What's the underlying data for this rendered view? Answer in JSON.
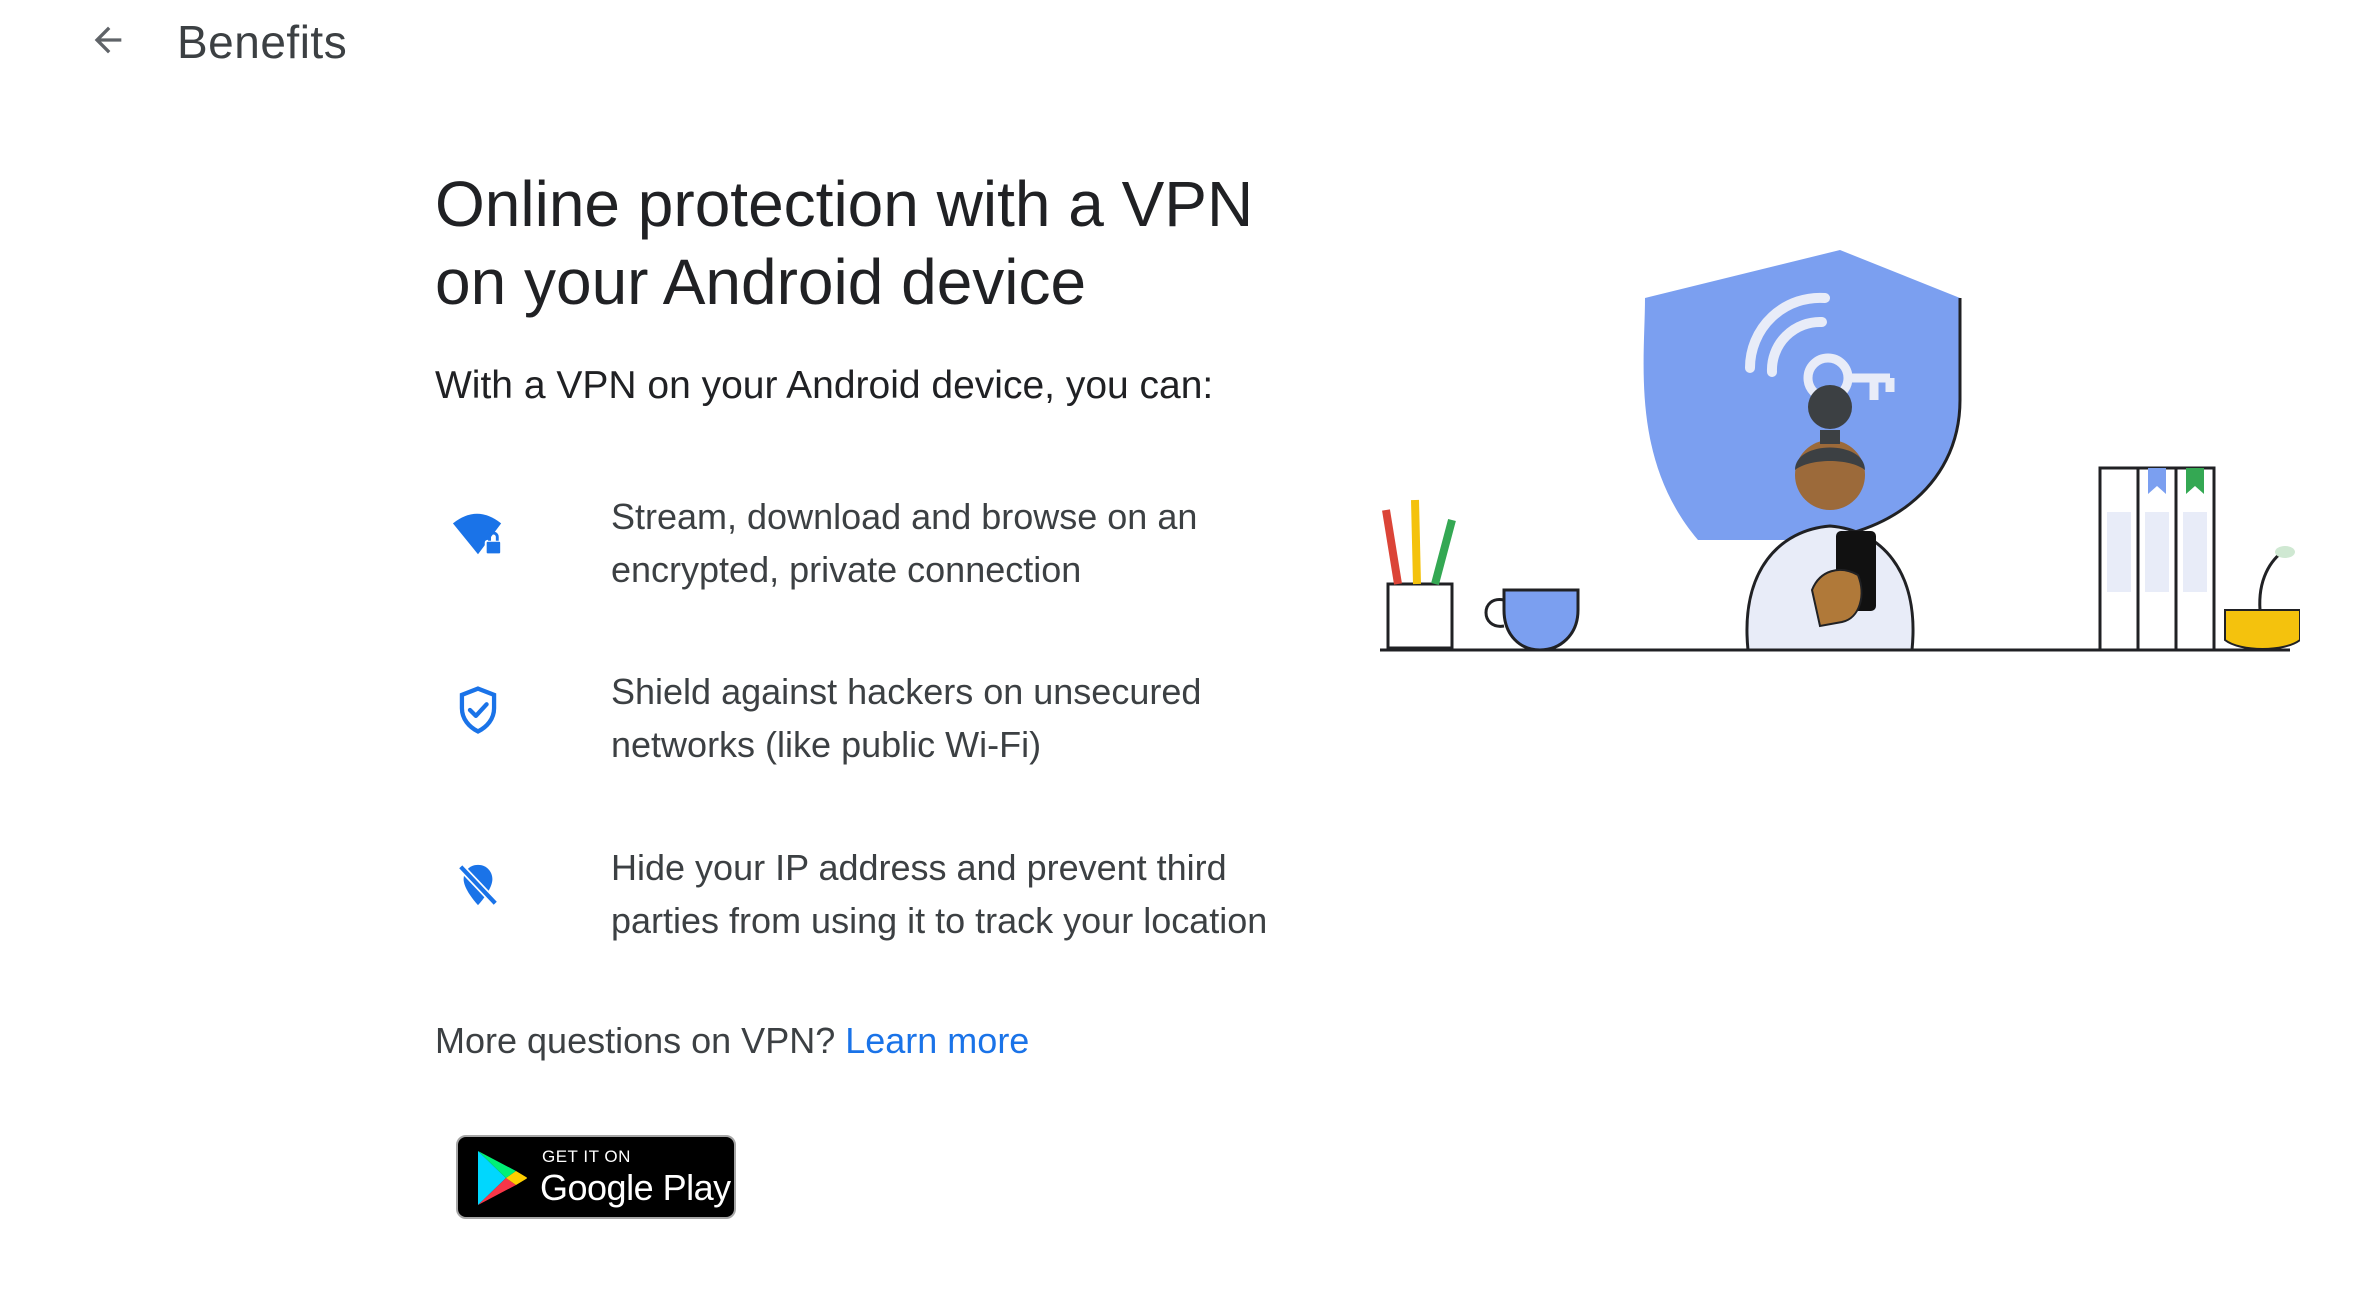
{
  "header": {
    "title": "Benefits",
    "back_icon": "arrow-back-icon"
  },
  "main": {
    "headline": "Online protection with a VPN on your Android device",
    "intro": "With a VPN on your Android device, you can:",
    "benefits": [
      {
        "icon": "wifi-lock-icon",
        "text": "Stream, download and browse on an encrypted, private connection"
      },
      {
        "icon": "shield-check-icon",
        "text": "Shield against hackers on unsecured networks (like public Wi-Fi)"
      },
      {
        "icon": "location-off-icon",
        "text": "Hide your IP address and prevent third parties from using it to track your location"
      }
    ],
    "more_questions": "More questions on VPN?",
    "learn_more": "Learn more"
  },
  "badge": {
    "small_text": "GET IT ON",
    "big_text": "Google Play"
  },
  "colors": {
    "accent_blue": "#1a73e8",
    "shield_blue": "#7b9ff0",
    "text_primary": "#202124",
    "text_secondary": "#3c4043"
  }
}
